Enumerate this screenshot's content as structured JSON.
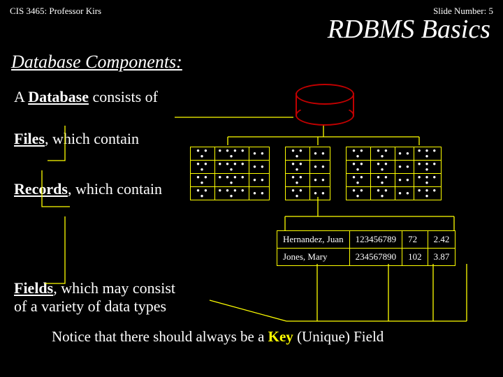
{
  "header": {
    "course": "CIS 3465: Professor Kirs",
    "slide": "Slide Number: 5"
  },
  "title": "RDBMS Basics",
  "section_heading": "Database Components:",
  "lines": {
    "db_prefix": "A ",
    "db_word": "Database",
    "db_suffix": " consists of",
    "files_word": "Files",
    "which_contain": " which contain",
    "records_word": "Records",
    "fields_word": "Fields",
    "fields_suffix": " which may consist",
    "fields_suffix2": "of a variety of data types"
  },
  "dots3": "● ● ●",
  "dots5": "● ● ● ● ●",
  "dots2": "● ●",
  "dots4": "● ● ● ●",
  "records": [
    {
      "name": "Hernandez, Juan",
      "id": "123456789",
      "v1": "72",
      "v2": "2.42"
    },
    {
      "name": "Jones, Mary",
      "id": "234567890",
      "v1": "102",
      "v2": "3.87"
    }
  ],
  "notice": {
    "prefix": "Notice that there should always be a ",
    "key": "Key",
    "suffix": " (Unique) Field"
  }
}
